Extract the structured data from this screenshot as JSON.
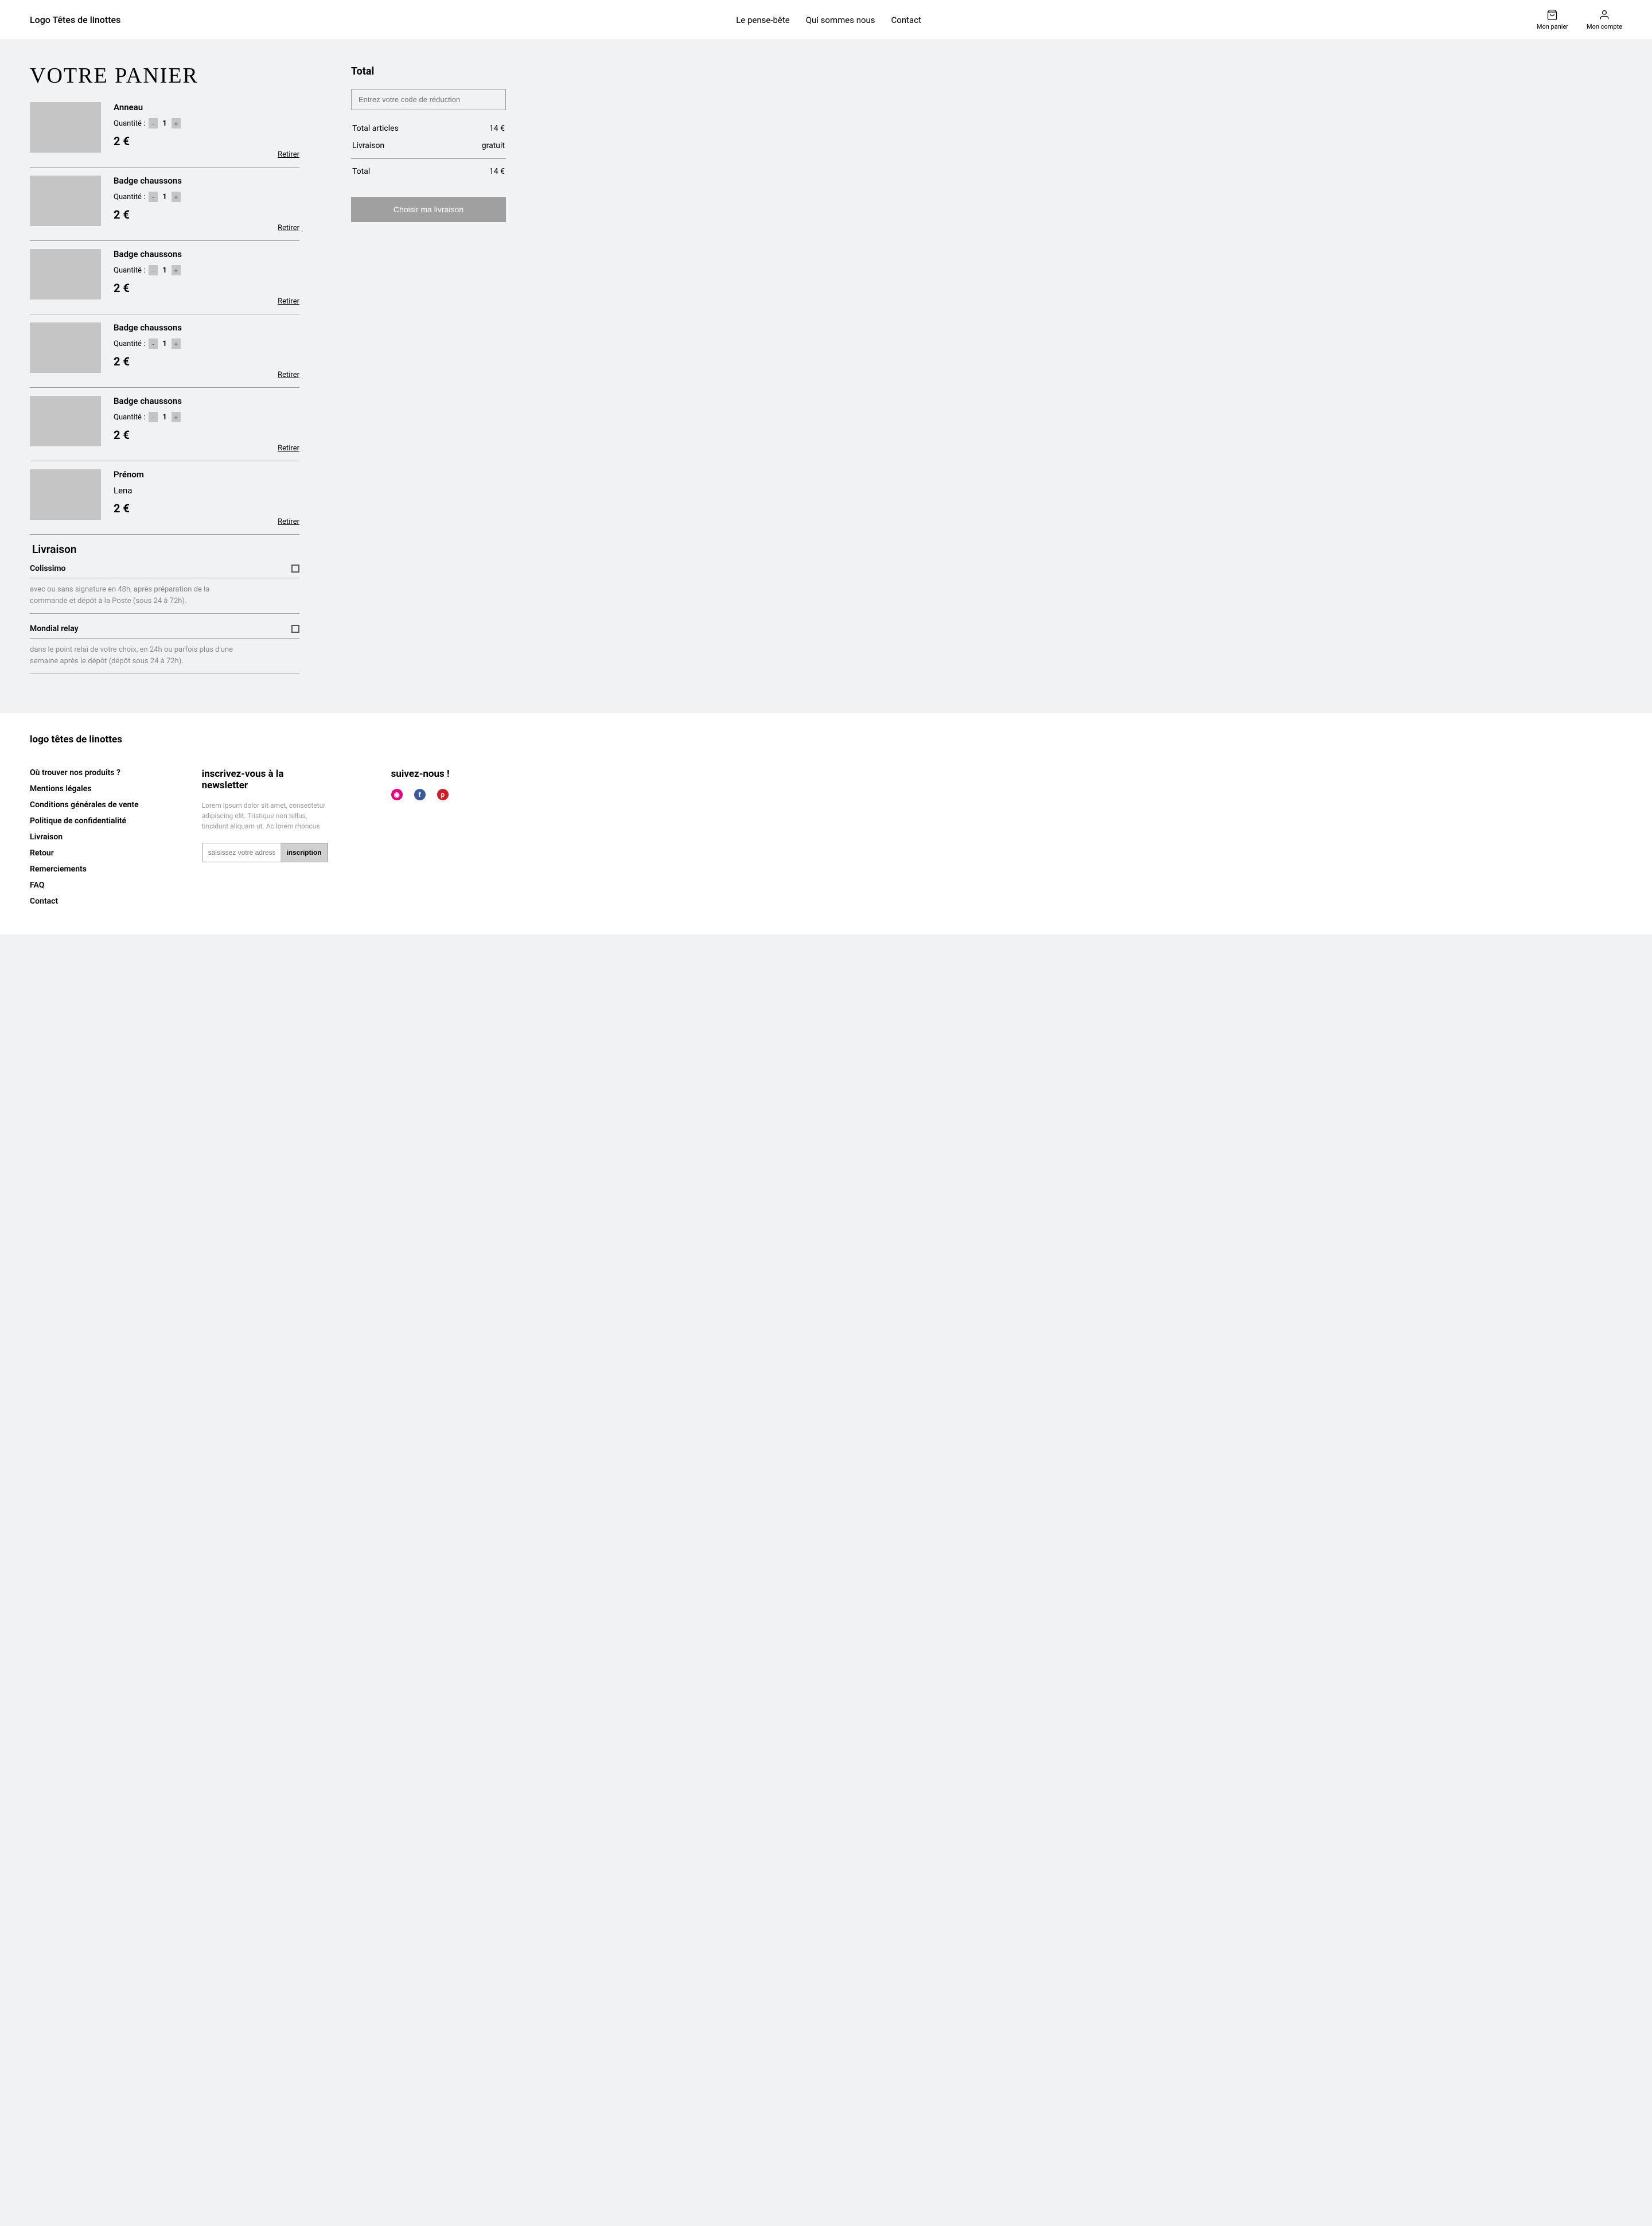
{
  "header": {
    "logo": "Logo Têtes de linottes",
    "nav": [
      "Le pense-bête",
      "Qui sommes nous",
      "Contact"
    ],
    "cart_label": "Mon panier",
    "account_label": "Mon compte"
  },
  "cart": {
    "title": "VOTRE PANIER",
    "qty_label": "Quantité :",
    "remove_label": "Retirer",
    "items": [
      {
        "name": "Anneau",
        "qty": "1",
        "price": "2 €"
      },
      {
        "name": "Badge chaussons",
        "qty": "1",
        "price": "2 €"
      },
      {
        "name": "Badge chaussons",
        "qty": "1",
        "price": "2 €"
      },
      {
        "name": "Badge chaussons",
        "qty": "1",
        "price": "2 €"
      },
      {
        "name": "Badge chaussons",
        "qty": "1",
        "price": "2 €"
      }
    ],
    "custom_item": {
      "label": "Prénom",
      "value": "Lena",
      "price": "2 €"
    }
  },
  "shipping": {
    "title": "Livraison",
    "options": [
      {
        "name": "Colissimo",
        "desc": "avec ou sans signature en 48h, après préparation de la commande et dépôt à la Poste (sous 24 à 72h)."
      },
      {
        "name": "Mondial relay",
        "desc": "dans le point relai de votre choix, en 24h ou parfois plus d'une semaine après le dépôt (dépôt sous 24 à 72h)."
      }
    ]
  },
  "summary": {
    "title": "Total",
    "promo_placeholder": "Entrez votre code de réduction",
    "rows": [
      {
        "label": "Total articles",
        "value": "14 €"
      },
      {
        "label": "Livraison",
        "value": "gratuit"
      }
    ],
    "total_label": "Total",
    "total_value": "14 €",
    "checkout": "Choisir ma livraison"
  },
  "footer": {
    "logo": "logo têtes de linottes",
    "links": [
      "Où trouver nos produits ?",
      "Mentions légales",
      "Conditions générales de vente",
      "Politique de confidentialité",
      "Livraison",
      "Retour",
      "Remerciements",
      "FAQ",
      "Contact"
    ],
    "newsletter": {
      "title": "inscrivez-vous à la newsletter",
      "desc": "Lorem ipsum dolor sit amet, consectetur adipiscing elit. Tristique non tellus, tincidunt aliquam ut. Ac lorem rhoncus",
      "placeholder": "saisissez votre adresse email",
      "button": "inscription"
    },
    "social_title": "suivez-nous !"
  }
}
